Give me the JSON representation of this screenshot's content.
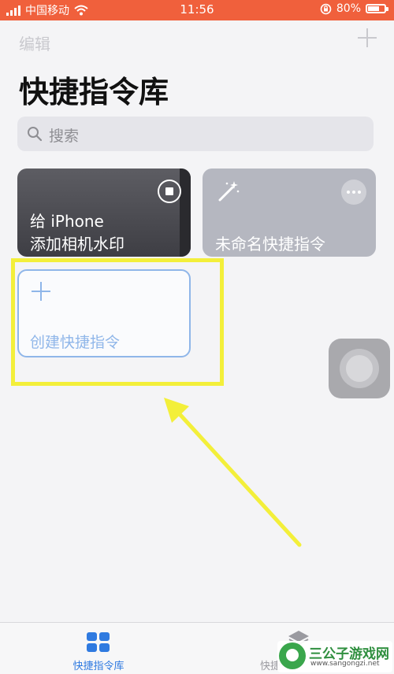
{
  "status_bar": {
    "carrier": "中国移动",
    "time": "11:56",
    "battery": "80%",
    "battery_level": 0.8
  },
  "nav": {
    "edit_label": "编辑",
    "add_icon": "plus-icon"
  },
  "page_title": "快捷指令库",
  "search": {
    "placeholder": "搜索",
    "icon": "search-icon"
  },
  "shortcuts": [
    {
      "line1": "给 iPhone",
      "line2": "添加相机水印",
      "icon": "stop-icon",
      "color": "#4a4a50"
    },
    {
      "title": "未命名快捷指令",
      "icon": "magic-wand-icon",
      "menu_icon": "more-icon",
      "color": "#b5b7c0"
    }
  ],
  "create_card": {
    "label": "创建快捷指令",
    "icon": "plus-icon",
    "color": "#8fb6e9"
  },
  "annotation": {
    "highlight_color": "#f3ef3a"
  },
  "tab_bar": {
    "tabs": [
      {
        "label": "快捷指令库",
        "icon": "grid-icon",
        "active": true
      },
      {
        "label": "快捷",
        "icon": "stack-icon",
        "active": false
      }
    ],
    "accent": "#2f7ae0"
  },
  "watermark": {
    "brand": "三公子游戏网",
    "url": "www.sangongzi.net"
  }
}
